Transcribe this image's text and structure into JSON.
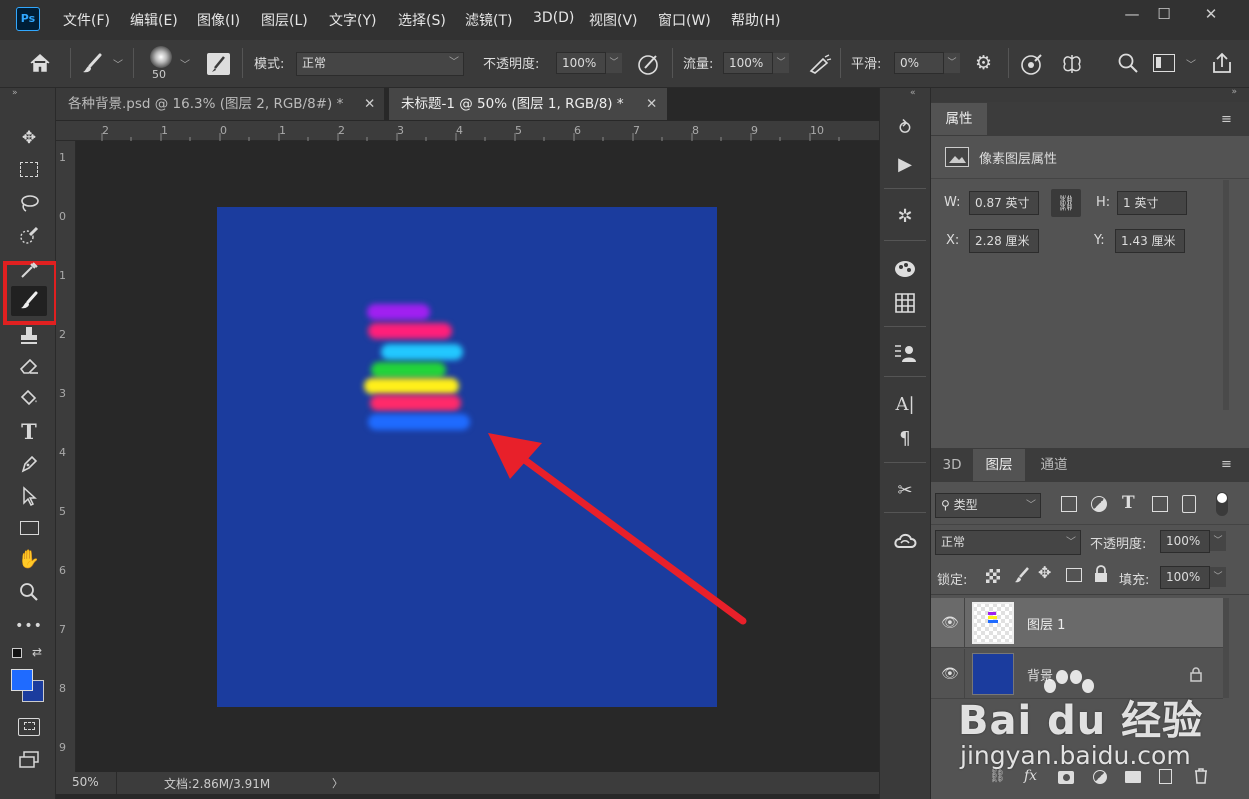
{
  "app": {
    "logo": "Ps",
    "accent": "#31a8ff"
  },
  "menu": [
    "文件(F)",
    "编辑(E)",
    "图像(I)",
    "图层(L)",
    "文字(Y)",
    "选择(S)",
    "滤镜(T)",
    "3D(D)",
    "视图(V)",
    "窗口(W)",
    "帮助(H)"
  ],
  "window_controls": {
    "minimize": "—",
    "restore": "☐",
    "close": "✕"
  },
  "options_bar": {
    "brush_size": "50",
    "mode_label": "模式:",
    "mode_value": "正常",
    "opacity_label": "不透明度:",
    "opacity_value": "100%",
    "flow_label": "流量:",
    "flow_value": "100%",
    "smooth_label": "平滑:",
    "smooth_value": "0%"
  },
  "tabs": [
    {
      "label": "各种背景.psd @ 16.3% (图层 2, RGB/8#) *",
      "close": "✕"
    },
    {
      "label": "未标题-1 @ 50% (图层 1, RGB/8) *",
      "close": "✕"
    }
  ],
  "rulers": {
    "h": [
      "2",
      "1",
      "0",
      "1",
      "2",
      "3",
      "4",
      "5",
      "6",
      "7",
      "8",
      "9",
      "10"
    ],
    "v": [
      "1",
      "0",
      "1",
      "2",
      "3",
      "4",
      "5",
      "6",
      "7",
      "8",
      "9"
    ]
  },
  "canvas": {
    "bg_color": "#1b3c9e",
    "stripe_colors": [
      "#a020f0",
      "#ff1f7a",
      "#22c8ff",
      "#22d43a",
      "#ffef1a",
      "#ff2a6a",
      "#1f6bff"
    ],
    "arrow_color": "#e8202a"
  },
  "status": {
    "zoom": "50%",
    "doc_info": "文档:2.86M/3.91M",
    "arrow": "〉"
  },
  "properties": {
    "tab": "属性",
    "layer_type": "像素图层属性",
    "w_label": "W:",
    "w_value": "0.87 英寸",
    "h_label": "H:",
    "h_value": "1 英寸",
    "x_label": "X:",
    "x_value": "2.28 厘米",
    "y_label": "Y:",
    "y_value": "1.43 厘米"
  },
  "layers_panel": {
    "tabs": [
      "3D",
      "图层",
      "通道"
    ],
    "filter_label": "类型",
    "blend_mode": "正常",
    "opacity_label": "不透明度:",
    "opacity_value": "100%",
    "lock_label": "锁定:",
    "fill_label": "填充:",
    "fill_value": "100%",
    "layers": [
      {
        "name": "图层 1",
        "selected": true
      },
      {
        "name": "背景",
        "locked": true
      }
    ]
  },
  "watermark": {
    "brand": "Bai du 经验",
    "url": "jingyan.baidu.com"
  }
}
